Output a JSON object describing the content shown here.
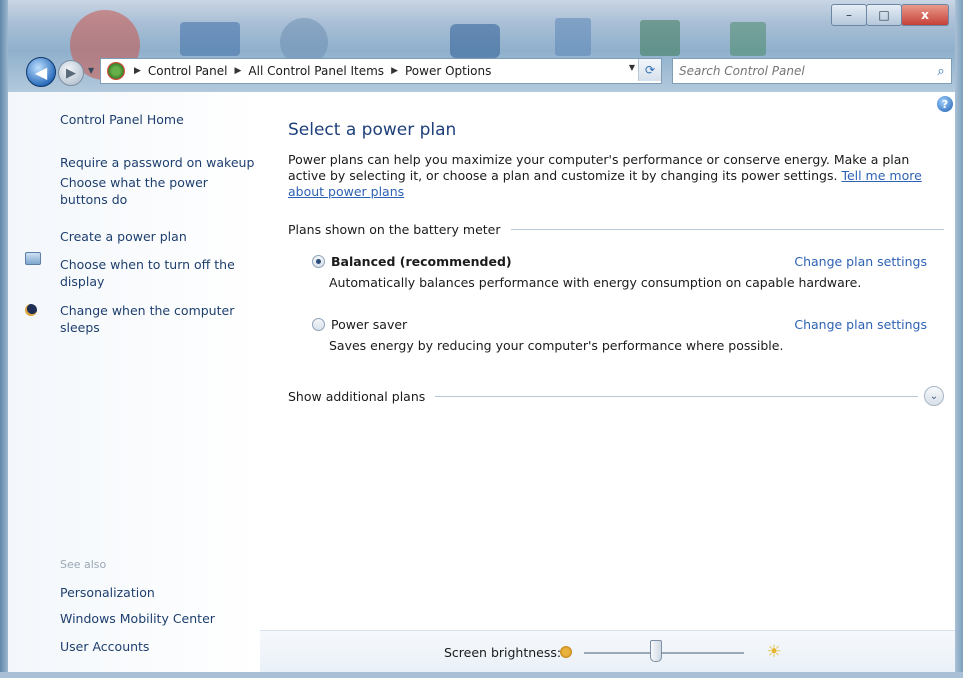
{
  "window": {
    "controls": {
      "minimize": "–",
      "maximize": "□",
      "close": "x"
    }
  },
  "address_bar": {
    "crumbs": [
      "Control Panel",
      "All Control Panel Items",
      "Power Options"
    ]
  },
  "search": {
    "placeholder": "Search Control Panel"
  },
  "left_pane": {
    "home": "Control Panel Home",
    "links": [
      "Require a password on wakeup",
      "Choose what the power buttons do",
      "Create a power plan",
      "Choose when to turn off the display",
      "Change when the computer sleeps"
    ],
    "see_also_heading": "See also",
    "see_also": [
      "Personalization",
      "Windows Mobility Center",
      "User Accounts"
    ]
  },
  "main": {
    "title": "Select a power plan",
    "description": "Power plans can help you maximize your computer's performance or conserve energy. Make a plan active by selecting it, or choose a plan and customize it by changing its power settings.",
    "tell_me_link": "Tell me more about power plans",
    "plans_heading": "Plans shown on the battery meter",
    "plans": [
      {
        "name": "Balanced (recommended)",
        "selected": true,
        "description": "Automatically balances performance with energy consumption on capable hardware.",
        "change_link": "Change plan settings"
      },
      {
        "name": "Power saver",
        "selected": false,
        "description": "Saves energy by reducing your computer's performance where possible.",
        "change_link": "Change plan settings"
      }
    ],
    "additional_plans": "Show additional plans"
  },
  "brightness": {
    "label": "Screen brightness:",
    "level": 0.45
  }
}
